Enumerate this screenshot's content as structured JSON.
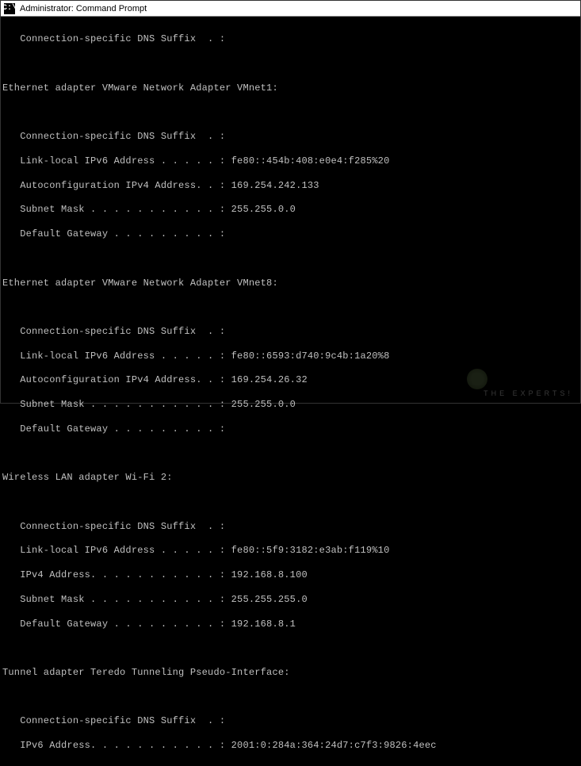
{
  "titlebar": {
    "icon_text": "C:\\",
    "title": "Administrator: Command Prompt"
  },
  "output": {
    "top_section": {
      "dns_suffix_label": "   Connection-specific DNS Suffix  . :"
    },
    "adapters": [
      {
        "header": "Ethernet adapter VMware Network Adapter VMnet1:",
        "lines": [
          {
            "label": "   Connection-specific DNS Suffix  . :",
            "value": ""
          },
          {
            "label": "   Link-local IPv6 Address . . . . . :",
            "value": " fe80::454b:408:e0e4:f285%20"
          },
          {
            "label": "   Autoconfiguration IPv4 Address. . :",
            "value": " 169.254.242.133"
          },
          {
            "label": "   Subnet Mask . . . . . . . . . . . :",
            "value": " 255.255.0.0"
          },
          {
            "label": "   Default Gateway . . . . . . . . . :",
            "value": ""
          }
        ]
      },
      {
        "header": "Ethernet adapter VMware Network Adapter VMnet8:",
        "lines": [
          {
            "label": "   Connection-specific DNS Suffix  . :",
            "value": ""
          },
          {
            "label": "   Link-local IPv6 Address . . . . . :",
            "value": " fe80::6593:d740:9c4b:1a20%8"
          },
          {
            "label": "   Autoconfiguration IPv4 Address. . :",
            "value": " 169.254.26.32"
          },
          {
            "label": "   Subnet Mask . . . . . . . . . . . :",
            "value": " 255.255.0.0"
          },
          {
            "label": "   Default Gateway . . . . . . . . . :",
            "value": ""
          }
        ]
      },
      {
        "header": "Wireless LAN adapter Wi-Fi 2:",
        "lines": [
          {
            "label": "   Connection-specific DNS Suffix  . :",
            "value": ""
          },
          {
            "label": "   Link-local IPv6 Address . . . . . :",
            "value": " fe80::5f9:3182:e3ab:f119%10"
          },
          {
            "label": "   IPv4 Address. . . . . . . . . . . :",
            "value": " 192.168.8.100"
          },
          {
            "label": "   Subnet Mask . . . . . . . . . . . :",
            "value": " 255.255.255.0"
          },
          {
            "label": "   Default Gateway . . . . . . . . . :",
            "value": " 192.168.8.1"
          }
        ]
      },
      {
        "header": "Tunnel adapter Teredo Tunneling Pseudo-Interface:",
        "lines": [
          {
            "label": "   Connection-specific DNS Suffix  . :",
            "value": ""
          },
          {
            "label": "   IPv6 Address. . . . . . . . . . . :",
            "value": " 2001:0:284a:364:24d7:c7f3:9826:4eec"
          }
        ]
      }
    ]
  },
  "watermark": {
    "text": "THE EXPERTS!"
  }
}
